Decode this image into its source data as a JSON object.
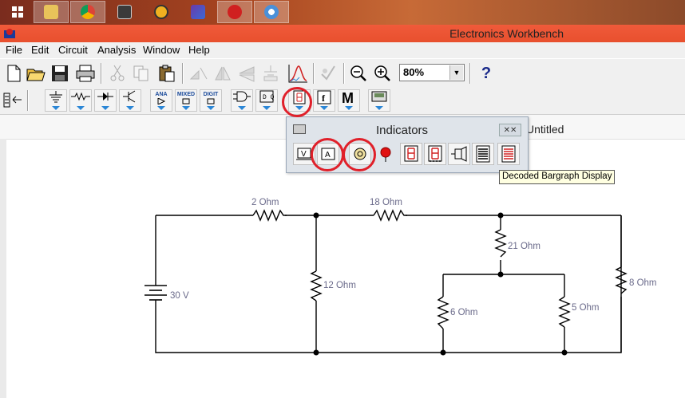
{
  "window": {
    "title": "Electronics Workbench"
  },
  "menu": [
    "File",
    "Edit",
    "Circuit",
    "Analysis",
    "Window",
    "Help"
  ],
  "toolbar": {
    "zoom": "80%",
    "help": "?"
  },
  "parts_bin": {
    "ana": "ANA",
    "mixed": "MIXED",
    "digit": "DIGIT"
  },
  "workspace": {
    "title": "Untitled"
  },
  "indicators_popup": {
    "title": "Indicators",
    "close": "✕✕"
  },
  "tooltip": "Decoded Bargraph Display",
  "circuit": {
    "battery": "30 V",
    "r1": "2  Ohm",
    "r2": "18  Ohm",
    "r3": "12  Ohm",
    "r4": "21  Ohm",
    "r5": "6  Ohm",
    "r6": "5  Ohm",
    "r7": "8  Ohm"
  },
  "colors": {
    "highlight": "#e0202a",
    "titlebar": "#e8502e",
    "accent": "#2a86d6"
  }
}
